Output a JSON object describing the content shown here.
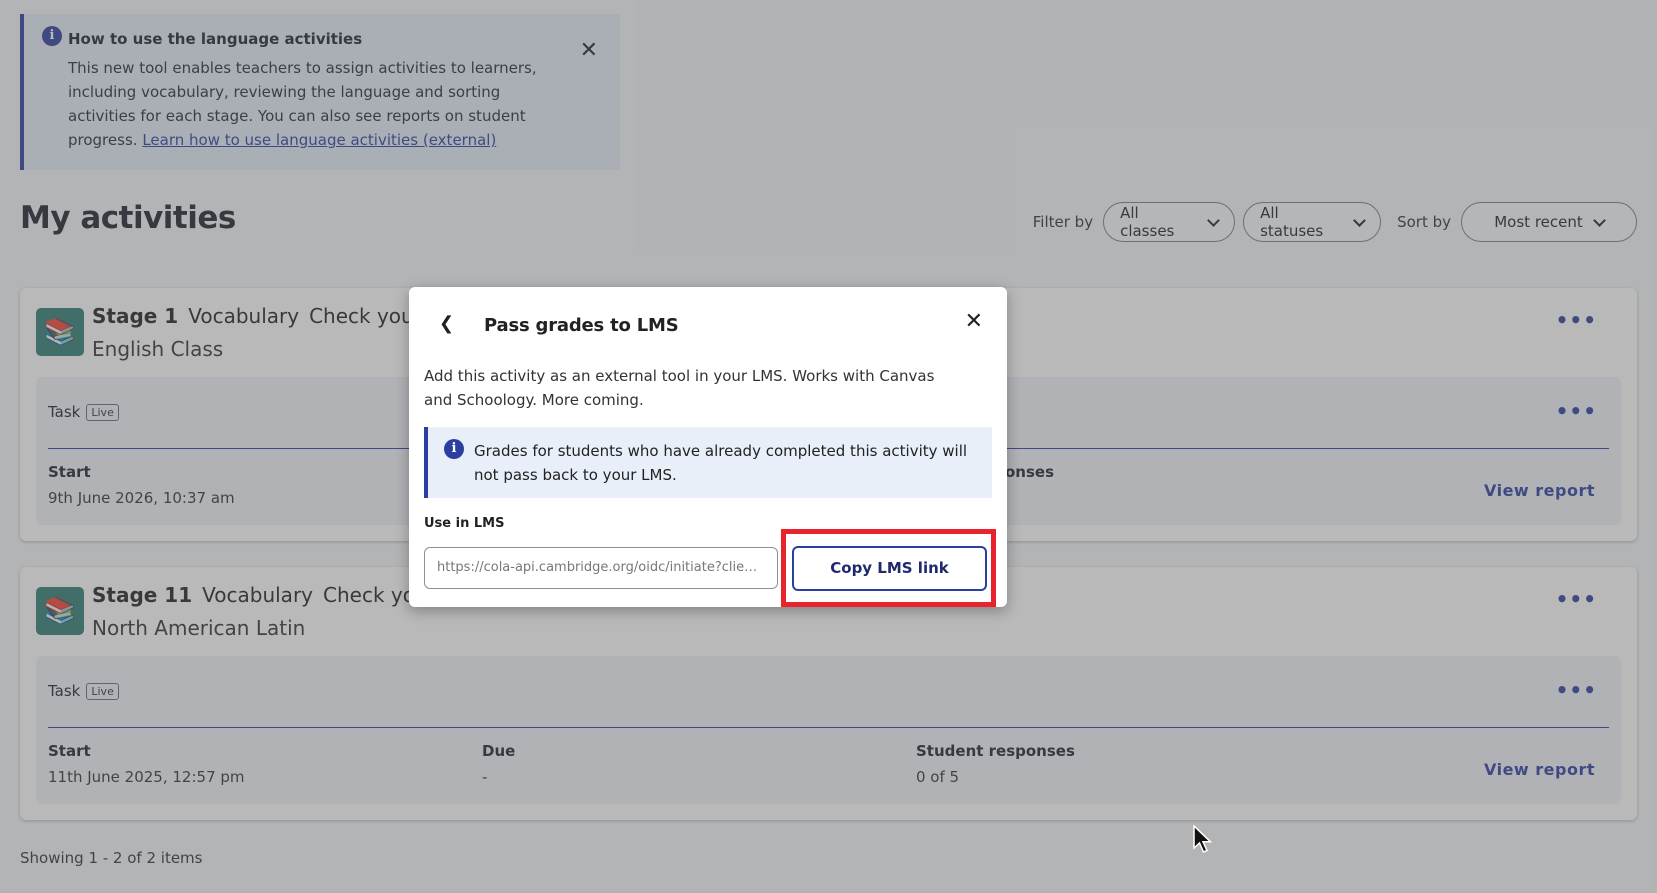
{
  "banner": {
    "title": "How to use the language activities",
    "body": "This new tool enables teachers to assign activities to learners, including vocabulary, reviewing the language and sorting activities for each stage. You can also see reports on student progress.",
    "link": "Learn how to use language activities (external)",
    "info_icon": "info-icon",
    "close_icon": "close-icon"
  },
  "page_title": "My activities",
  "filters": {
    "filter_by_label": "Filter by",
    "classes": "All classes",
    "statuses": "All statuses",
    "sort_by_label": "Sort by",
    "sort": "Most recent"
  },
  "activities": [
    {
      "stage": "Stage 1",
      "type": "Vocabulary",
      "title": "Check your voc",
      "class": "English Class",
      "task_label": "Task",
      "status": "Live",
      "start_label": "Start",
      "start": "9th June 2026, 10:37 am",
      "responses_label": "onses",
      "view_report": "View report"
    },
    {
      "stage": "Stage 11",
      "type": "Vocabulary",
      "title": "Check your v",
      "class": "North American Latin",
      "task_label": "Task",
      "status": "Live",
      "start_label": "Start",
      "start": "11th June 2025, 12:57 pm",
      "due_label": "Due",
      "due": "-",
      "responses_label": "Student responses",
      "responses": "0 of 5",
      "view_report": "View report"
    }
  ],
  "showing": "Showing 1 - 2 of 2 items",
  "modal": {
    "title": "Pass grades to LMS",
    "description": "Add this activity as an external tool in your LMS. Works with Canvas and Schoology. More coming.",
    "note": "Grades for students who have already completed this activity will not pass back to your LMS.",
    "use_label": "Use in LMS",
    "lms_url": "https://cola-api.cambridge.org/oidc/initiate?client_...",
    "copy_button": "Copy LMS link"
  },
  "colors": {
    "accent": "#2c3fa0",
    "highlight": "#e8232b",
    "avatar_bg": "#2f7d72"
  }
}
